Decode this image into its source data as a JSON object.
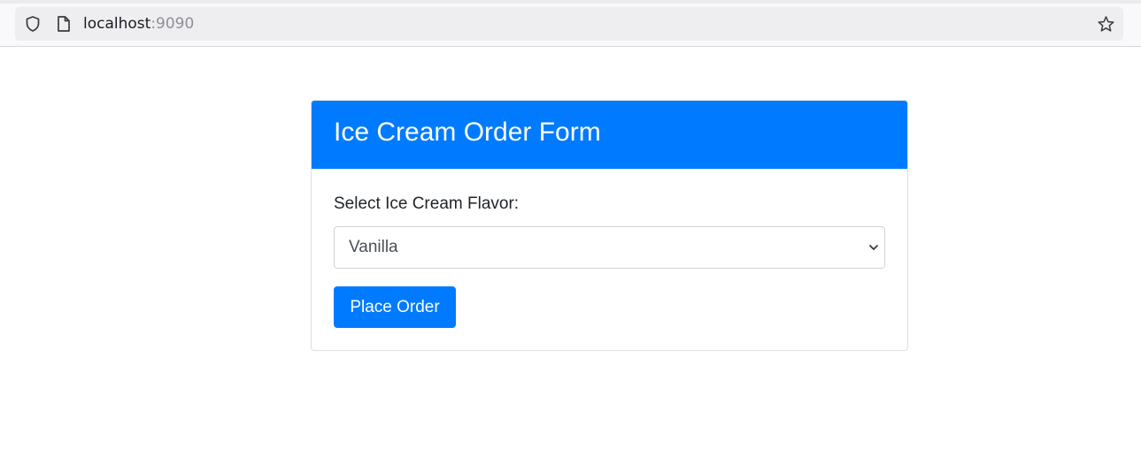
{
  "browser": {
    "url_host": "localhost",
    "url_port": ":9090",
    "icons": {
      "security": "shield-icon",
      "page": "page-icon",
      "bookmark": "star-icon"
    }
  },
  "card": {
    "title": "Ice Cream Order Form",
    "flavor_label": "Select Ice Cream Flavor:",
    "flavor_selected": "Vanilla",
    "submit_label": "Place Order"
  },
  "colors": {
    "primary": "#007bff",
    "text": "#212529",
    "muted_text": "#495057",
    "border": "#ced4da"
  }
}
